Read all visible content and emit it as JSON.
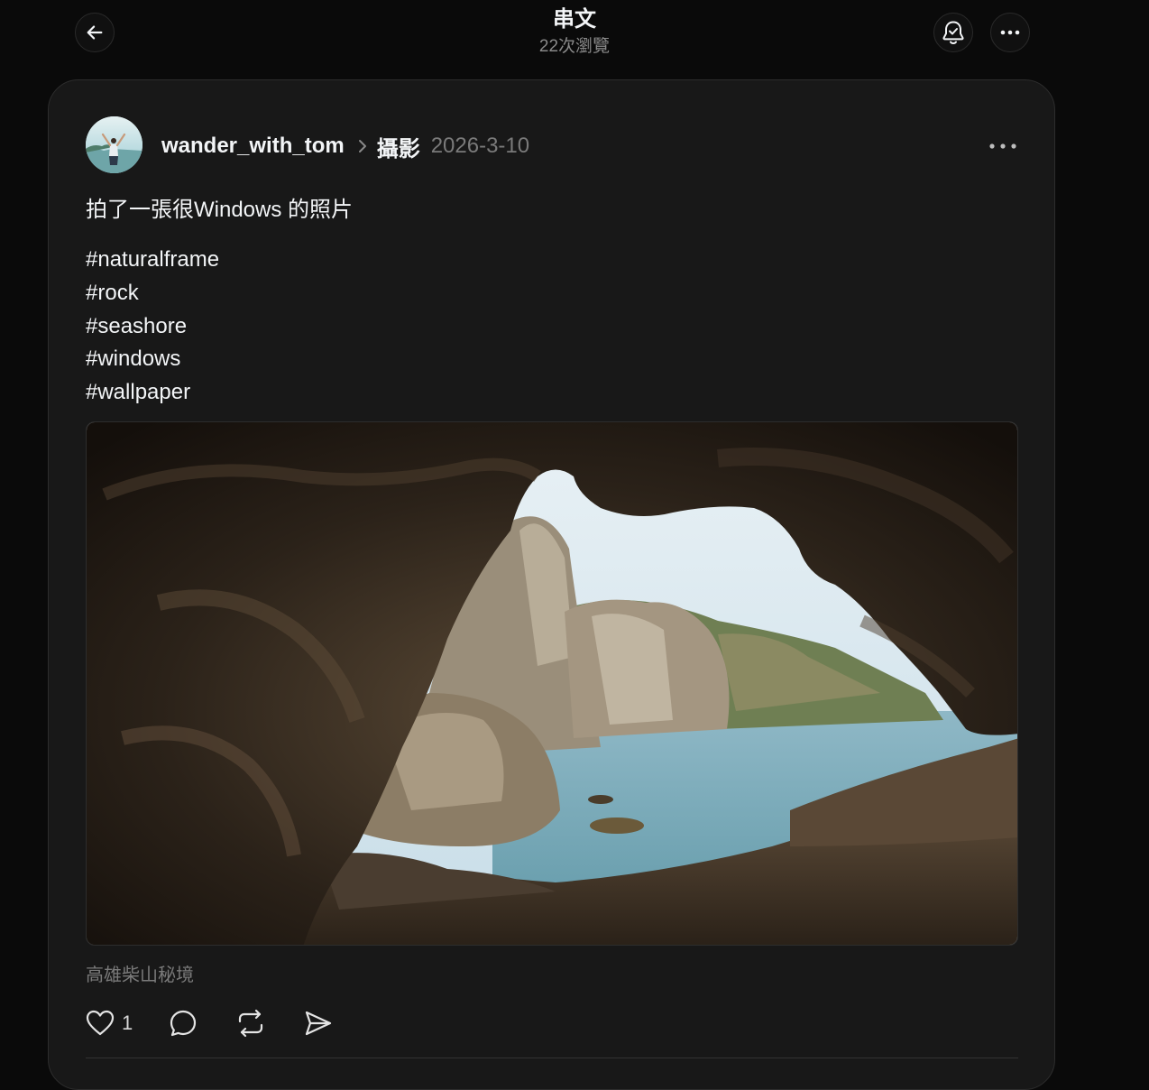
{
  "header": {
    "title": "串文",
    "views": "22次瀏覽"
  },
  "post": {
    "username": "wander_with_tom",
    "topic": "攝影",
    "date": "2026-3-10",
    "text": "拍了一張很Windows 的照片",
    "tags": [
      "#naturalframe",
      "#rock",
      "#seashore",
      "#windows",
      "#wallpaper"
    ],
    "location": "高雄柴山秘境",
    "likes": "1"
  },
  "icons": {
    "back": "arrow-left-icon",
    "notify": "bell-check-icon",
    "more": "more-horizontal-icon",
    "like": "heart-icon",
    "comment": "comment-icon",
    "repost": "repost-icon",
    "share": "send-icon"
  }
}
